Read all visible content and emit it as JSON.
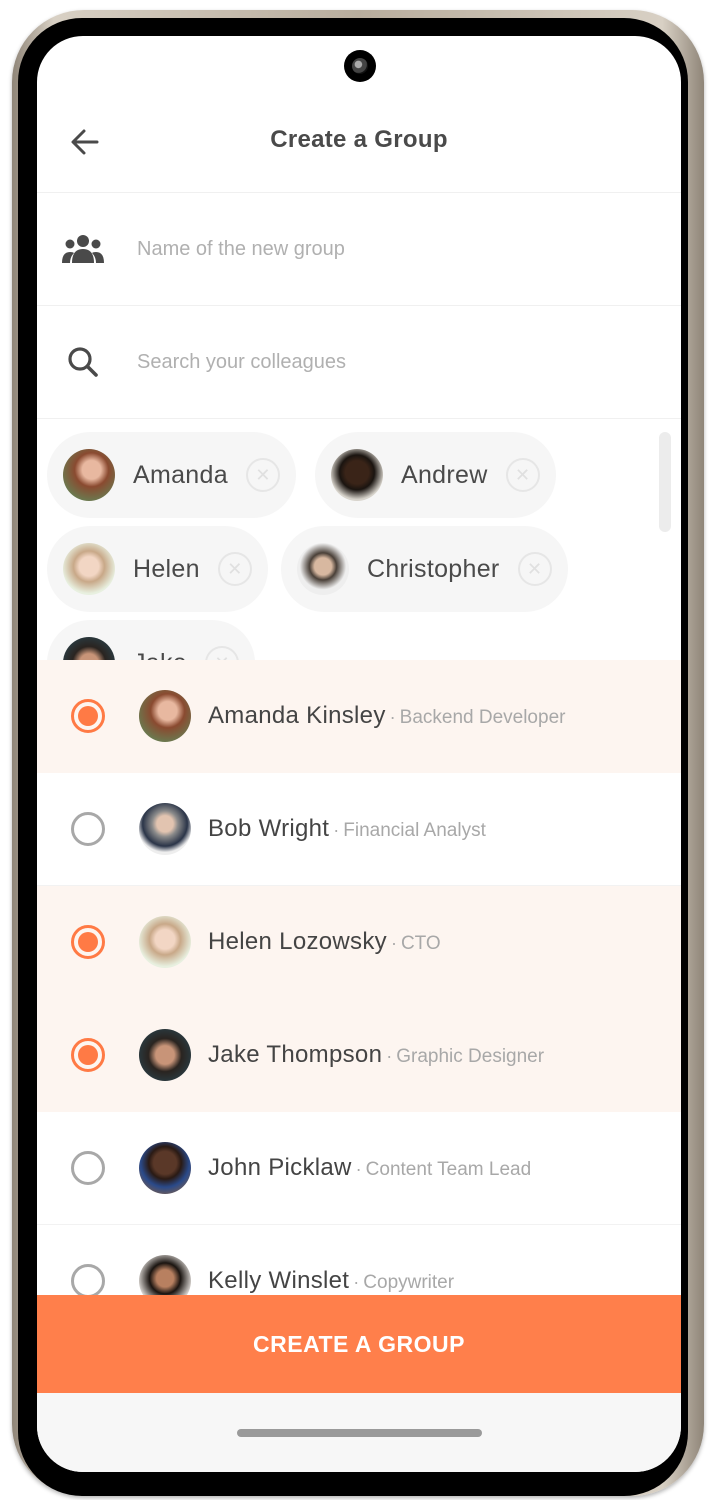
{
  "header": {
    "title": "Create a Group",
    "back_icon": "arrow-left-icon"
  },
  "group_name_field": {
    "icon": "group-icon",
    "placeholder": "Name of the new group",
    "value": ""
  },
  "search_field": {
    "icon": "search-icon",
    "placeholder": "Search your colleagues",
    "value": ""
  },
  "selected_chips": [
    {
      "label": "Amanda",
      "close_icon": "close-circle-icon"
    },
    {
      "label": "Andrew",
      "close_icon": "close-circle-icon"
    },
    {
      "label": "Helen",
      "close_icon": "close-circle-icon"
    },
    {
      "label": "Christopher",
      "close_icon": "close-circle-icon"
    },
    {
      "label": "Jake",
      "close_icon": "close-circle-icon"
    }
  ],
  "colleagues": [
    {
      "name": "Amanda Kinsley",
      "separator": "·",
      "role": "Backend Developer",
      "selected": true
    },
    {
      "name": "Bob Wright",
      "separator": "·",
      "role": "Financial Analyst",
      "selected": false
    },
    {
      "name": "Helen Lozowsky",
      "separator": "·",
      "role": "CTO",
      "selected": true
    },
    {
      "name": "Jake Thompson",
      "separator": "·",
      "role": "Graphic Designer",
      "selected": true
    },
    {
      "name": "John Picklaw",
      "separator": "·",
      "role": "Content Team Lead",
      "selected": false
    },
    {
      "name": "Kelly Winslet",
      "separator": "·",
      "role": "Copywriter",
      "selected": false
    }
  ],
  "cta": {
    "label": "CREATE A GROUP"
  },
  "colors": {
    "accent": "#ff7f4b",
    "selected_row_bg": "#fdf5f0",
    "text_primary": "#444444",
    "text_secondary": "#a8a8a8"
  }
}
